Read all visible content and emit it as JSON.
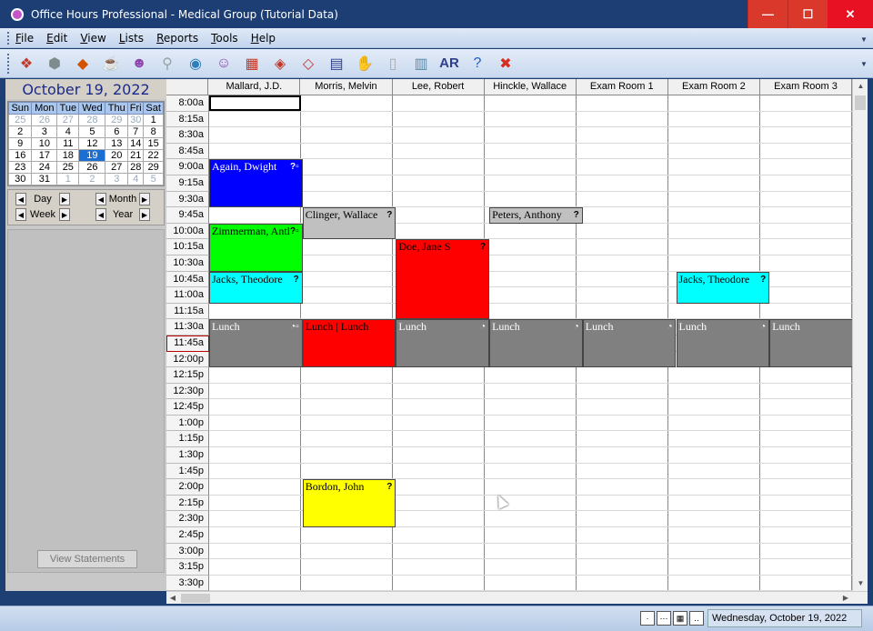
{
  "window": {
    "title": "Office Hours Professional - Medical Group (Tutorial Data)",
    "min_glyph": "—",
    "max_glyph": "☐",
    "close_glyph": "✕"
  },
  "menu": [
    "File",
    "Edit",
    "View",
    "Lists",
    "Reports",
    "Tools",
    "Help"
  ],
  "toolbar": {
    "icons": [
      {
        "name": "new-appointment-icon",
        "glyph": "❖",
        "color": "#c0392b"
      },
      {
        "name": "patients-icon",
        "glyph": "⬢",
        "color": "#7f8c8d"
      },
      {
        "name": "schedule-book-icon",
        "glyph": "◆",
        "color": "#d35400"
      },
      {
        "name": "cup-icon",
        "glyph": "☕",
        "color": "#7f8c8d"
      },
      {
        "name": "providers-icon",
        "glyph": "☻",
        "color": "#8e44ad"
      },
      {
        "name": "stamp-icon",
        "glyph": "⚲",
        "color": "#95a5a6"
      },
      {
        "name": "globe-icon",
        "glyph": "◉",
        "color": "#2c7fb8"
      },
      {
        "name": "people-icon",
        "glyph": "☺",
        "color": "#8e44ad"
      },
      {
        "name": "calendar-icon",
        "glyph": "▦",
        "color": "#c0392b"
      },
      {
        "name": "book-open-icon",
        "glyph": "◈",
        "color": "#c0392b"
      },
      {
        "name": "book-closed-icon",
        "glyph": "◇",
        "color": "#c0392b"
      },
      {
        "name": "ledger-icon",
        "glyph": "▤",
        "color": "#2c3e8c"
      },
      {
        "name": "hand-coin-icon",
        "glyph": "✋",
        "color": "#d4a017"
      },
      {
        "name": "document-icon",
        "glyph": "▯",
        "color": "#aaaaaa"
      },
      {
        "name": "statement-icon",
        "glyph": "▥",
        "color": "#5d8aa8"
      },
      {
        "name": "ar-icon",
        "glyph": "AR",
        "color": "#2c3e8c"
      },
      {
        "name": "help-icon",
        "glyph": "?",
        "color": "#1f5fbf"
      },
      {
        "name": "exit-icon",
        "glyph": "✖",
        "color": "#d62d20"
      }
    ]
  },
  "calendar": {
    "title": "October 19, 2022",
    "days": [
      "Sun",
      "Mon",
      "Tue",
      "Wed",
      "Thu",
      "Fri",
      "Sat"
    ],
    "weeks": [
      [
        {
          "d": "25",
          "o": true
        },
        {
          "d": "26",
          "o": true
        },
        {
          "d": "27",
          "o": true
        },
        {
          "d": "28",
          "o": true
        },
        {
          "d": "29",
          "o": true
        },
        {
          "d": "30",
          "o": true
        },
        {
          "d": "1"
        }
      ],
      [
        {
          "d": "2"
        },
        {
          "d": "3"
        },
        {
          "d": "4"
        },
        {
          "d": "5"
        },
        {
          "d": "6"
        },
        {
          "d": "7"
        },
        {
          "d": "8"
        }
      ],
      [
        {
          "d": "9"
        },
        {
          "d": "10"
        },
        {
          "d": "11"
        },
        {
          "d": "12"
        },
        {
          "d": "13"
        },
        {
          "d": "14"
        },
        {
          "d": "15"
        }
      ],
      [
        {
          "d": "16"
        },
        {
          "d": "17"
        },
        {
          "d": "18"
        },
        {
          "d": "19",
          "t": true
        },
        {
          "d": "20"
        },
        {
          "d": "21"
        },
        {
          "d": "22"
        }
      ],
      [
        {
          "d": "23"
        },
        {
          "d": "24"
        },
        {
          "d": "25"
        },
        {
          "d": "26"
        },
        {
          "d": "27"
        },
        {
          "d": "28"
        },
        {
          "d": "29"
        }
      ],
      [
        {
          "d": "30"
        },
        {
          "d": "31"
        },
        {
          "d": "1",
          "o": true
        },
        {
          "d": "2",
          "o": true
        },
        {
          "d": "3",
          "o": true
        },
        {
          "d": "4",
          "o": true
        },
        {
          "d": "5",
          "o": true
        }
      ]
    ]
  },
  "nav": {
    "day": "Day",
    "week": "Week",
    "month": "Month",
    "year": "Year",
    "prev": "◀",
    "next": "▶"
  },
  "view_statements": "View Statements",
  "columns": [
    "Mallard, J.D.",
    "Morris, Melvin",
    "Lee, Robert",
    "Hinckle, Wallace",
    "Exam Room 1",
    "Exam Room 2",
    "Exam Room 3"
  ],
  "times": [
    "8:00a",
    "8:15a",
    "8:30a",
    "8:45a",
    "9:00a",
    "9:15a",
    "9:30a",
    "9:45a",
    "10:00a",
    "10:15a",
    "10:30a",
    "10:45a",
    "11:00a",
    "11:15a",
    "11:30a",
    "11:45a",
    "12:00p",
    "12:15p",
    "12:30p",
    "12:45p",
    "1:00p",
    "1:15p",
    "1:30p",
    "1:45p",
    "2:00p",
    "2:15p",
    "2:30p",
    "2:45p",
    "3:00p",
    "3:15p",
    "3:30p"
  ],
  "current_time": "11:45a",
  "appointments": [
    {
      "name": "Again, Dwight",
      "col": 0,
      "start": 4,
      "len": 3,
      "bg": "#0000ff",
      "fg": "#ffffff",
      "flag": "?▫"
    },
    {
      "name": "Clinger, Wallace",
      "col": 1,
      "start": 7,
      "len": 2,
      "bg": "#c0c0c0",
      "fg": "#000000",
      "flag": "?"
    },
    {
      "name": "Peters, Anthony",
      "col": 3,
      "start": 7,
      "len": 1,
      "bg": "#c0c0c0",
      "fg": "#000000",
      "flag": "?"
    },
    {
      "name": "Zimmerman, Antl",
      "col": 0,
      "start": 8,
      "len": 3,
      "bg": "#00ff00",
      "fg": "#000000",
      "flag": "?▫"
    },
    {
      "name": "Doe, Jane S",
      "col": 2,
      "start": 9,
      "len": 5,
      "bg": "#ff0000",
      "fg": "#000000",
      "flag": "?"
    },
    {
      "name": "Jacks, Theodore",
      "col": 0,
      "start": 11,
      "len": 2,
      "bg": "#00ffff",
      "fg": "#000000",
      "flag": "?"
    },
    {
      "name": "Jacks, Theodore",
      "col": 5,
      "start": 11,
      "len": 2,
      "bg": "#00ffff",
      "fg": "#000000",
      "flag": "?"
    },
    {
      "name": "Lunch",
      "col": 0,
      "start": 14,
      "len": 3,
      "bg": "#808080",
      "fg": "#ffffff",
      "flag": "◔▫"
    },
    {
      "name": "Lunch | Lunch",
      "col": 1,
      "start": 14,
      "len": 3,
      "bg": "#ff0000",
      "fg": "#000000",
      "flag": ""
    },
    {
      "name": "Lunch",
      "col": 2,
      "start": 14,
      "len": 3,
      "bg": "#808080",
      "fg": "#ffffff",
      "flag": "◔"
    },
    {
      "name": "Lunch",
      "col": 3,
      "start": 14,
      "len": 3,
      "bg": "#808080",
      "fg": "#ffffff",
      "flag": "◔"
    },
    {
      "name": "Lunch",
      "col": 4,
      "start": 14,
      "len": 3,
      "bg": "#808080",
      "fg": "#ffffff",
      "flag": "◔"
    },
    {
      "name": "Lunch",
      "col": 5,
      "start": 14,
      "len": 3,
      "bg": "#808080",
      "fg": "#ffffff",
      "flag": "◔"
    },
    {
      "name": "Lunch",
      "col": 6,
      "start": 14,
      "len": 3,
      "bg": "#808080",
      "fg": "#ffffff",
      "flag": ""
    },
    {
      "name": "Bordon, John",
      "col": 1,
      "start": 24,
      "len": 3,
      "bg": "#ffff00",
      "fg": "#000000",
      "flag": "?"
    }
  ],
  "statusbar": {
    "date": "Wednesday, October 19, 2022",
    "buttons": [
      {
        "name": "view-single-icon",
        "glyph": "·"
      },
      {
        "name": "view-row-icon",
        "glyph": "⋯"
      },
      {
        "name": "view-grid-icon",
        "glyph": "▦"
      },
      {
        "name": "view-extend-icon",
        "glyph": "‥"
      }
    ]
  }
}
